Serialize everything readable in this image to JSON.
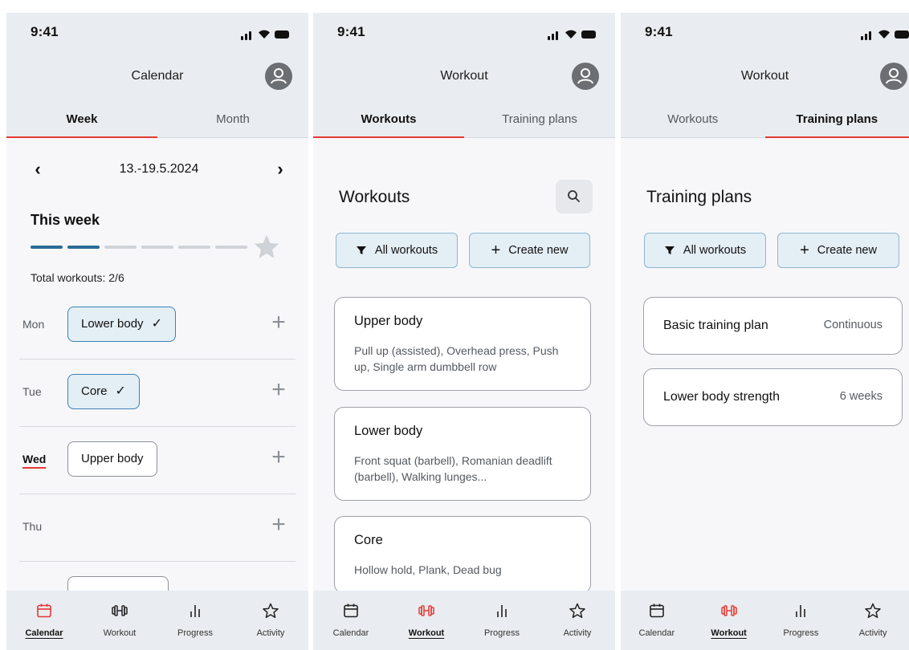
{
  "colors": {
    "accent": "#e53935",
    "primary": "#2a6c96",
    "chip_bg": "#e3eef5",
    "header_bg": "#e9ecf0"
  },
  "status": {
    "time": "9:41"
  },
  "screens": [
    {
      "title": "Calendar",
      "tabs": [
        {
          "label": "Week",
          "active": true
        },
        {
          "label": "Month",
          "active": false
        }
      ],
      "week_range": "13.-19.5.2024",
      "section_title": "This week",
      "progress": {
        "done": 2,
        "total": 6
      },
      "total_label": "Total workouts: 2/6",
      "days": [
        {
          "day": "Mon",
          "workout": "Lower body",
          "status": "done"
        },
        {
          "day": "Tue",
          "workout": "Core",
          "status": "done"
        },
        {
          "day": "Wed",
          "workout": "Upper body",
          "status": "planned",
          "today": true
        },
        {
          "day": "Thu",
          "workout": "",
          "status": "none"
        }
      ]
    },
    {
      "title": "Workout",
      "tabs": [
        {
          "label": "Workouts",
          "active": true
        },
        {
          "label": "Training plans",
          "active": false
        }
      ],
      "section_title": "Workouts",
      "filter_label": "All workouts",
      "create_label": "Create new",
      "cards": [
        {
          "title": "Upper body",
          "desc": "Pull up (assisted), Overhead press, Push up, Single arm dumbbell row"
        },
        {
          "title": "Lower body",
          "desc": "Front squat (barbell), Romanian deadlift (barbell), Walking lunges..."
        },
        {
          "title": "Core",
          "desc": "Hollow hold, Plank, Dead bug"
        }
      ]
    },
    {
      "title": "Workout",
      "tabs": [
        {
          "label": "Workouts",
          "active": false
        },
        {
          "label": "Training plans",
          "active": true
        }
      ],
      "section_title": "Training plans",
      "filter_label": "All workouts",
      "create_label": "Create new",
      "plans": [
        {
          "title": "Basic training plan",
          "meta": "Continuous"
        },
        {
          "title": "Lower body strength",
          "meta": "6 weeks"
        }
      ]
    }
  ],
  "bottom_nav": [
    {
      "label": "Calendar",
      "icon": "calendar-icon"
    },
    {
      "label": "Workout",
      "icon": "dumbbell-icon"
    },
    {
      "label": "Progress",
      "icon": "bar-chart-icon"
    },
    {
      "label": "Activity",
      "icon": "star-icon"
    }
  ],
  "active_nav": [
    "Calendar",
    "Workout",
    "Workout"
  ]
}
